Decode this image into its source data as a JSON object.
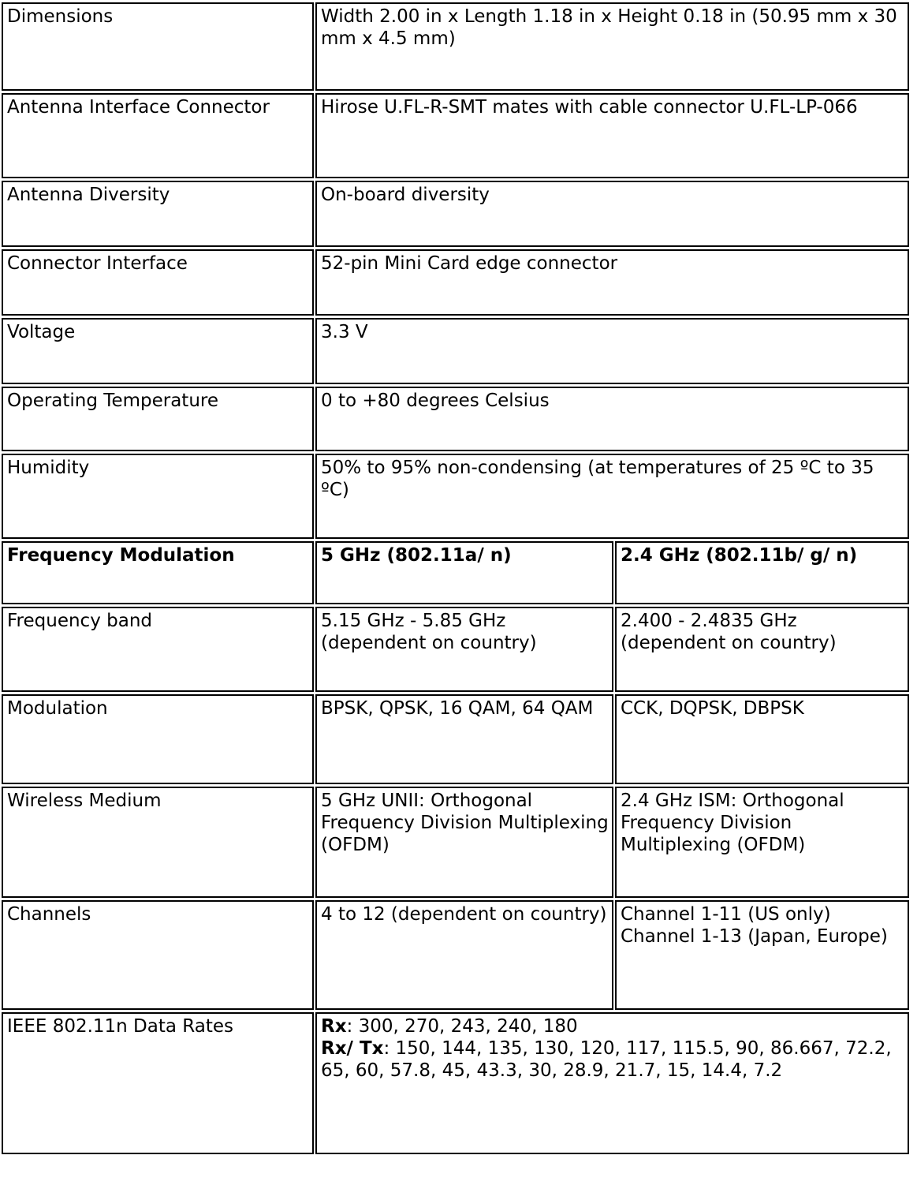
{
  "table": {
    "rows": [
      {
        "id": "dimensions",
        "label": "Dimensions",
        "value": "Width 2.00 in x Length 1.18 in x Height 0.18 in (50.95 mm x 30 mm x 4.5 mm)",
        "span": 2
      },
      {
        "id": "antenna-interface-connector",
        "label": "Antenna Interface Connector",
        "value": "Hirose U.FL-R-SMT mates with cable connector U.FL-LP-066",
        "span": 2
      },
      {
        "id": "antenna-diversity",
        "label": "Antenna Diversity",
        "value": "On-board diversity",
        "span": 2
      },
      {
        "id": "connector-interface",
        "label": "Connector Interface",
        "value": "52-pin Mini Card edge connector",
        "span": 2
      },
      {
        "id": "voltage",
        "label": "Voltage",
        "value": "3.3 V",
        "span": 2
      },
      {
        "id": "operating-temperature",
        "label": "Operating Temperature",
        "value": "0 to +80 degrees Celsius",
        "span": 2
      },
      {
        "id": "humidity",
        "label": "Humidity",
        "value": "50% to 95% non-condensing (at temperatures of 25 ºC to 35 ºC)",
        "span": 2
      },
      {
        "id": "frequency-modulation",
        "label": "Frequency Modulation",
        "value_5ghz": "5 GHz (802.11a/ n)",
        "value_24ghz": "2.4 GHz (802.11b/ g/ n)",
        "header": true
      },
      {
        "id": "frequency-band",
        "label": "Frequency band",
        "value_5ghz": "5.15 GHz - 5.85 GHz (dependent on country)",
        "value_24ghz": "2.400 - 2.4835 GHz (dependent on country)"
      },
      {
        "id": "modulation",
        "label": "Modulation",
        "value_5ghz": "BPSK, QPSK, 16 QAM, 64 QAM",
        "value_24ghz": "CCK, DQPSK, DBPSK"
      },
      {
        "id": "wireless-medium",
        "label": "Wireless Medium",
        "value_5ghz": "5 GHz UNII: Orthogonal Frequency Division Multiplexing (OFDM)",
        "value_24ghz": "2.4 GHz ISM: Orthogonal Frequency Division Multiplexing (OFDM)"
      },
      {
        "id": "channels",
        "label": "Channels",
        "value_5ghz": "4 to 12 (dependent on country)",
        "value_24ghz": "Channel 1-11 (US only) Channel 1-13 (Japan, Europe)"
      },
      {
        "id": "ieee-802-11n-data-rates",
        "label": "IEEE 802.11n Data Rates",
        "span": 2,
        "rx_label": "Rx",
        "rx_values": ": 300, 270, 243, 240, 180",
        "rxtx_label": "Rx/ Tx",
        "rxtx_values": ": 150, 144, 135, 130, 120, 117, 115.5, 90, 86.667, 72.2, 65, 60, 57.8, 45, 43.3, 30, 28.9, 21.7, 15, 14.4, 7.2"
      }
    ],
    "channels_24ghz_lines": [
      "Channel 1-11 (US only)",
      "Channel 1-13 (Japan, Europe)"
    ]
  }
}
